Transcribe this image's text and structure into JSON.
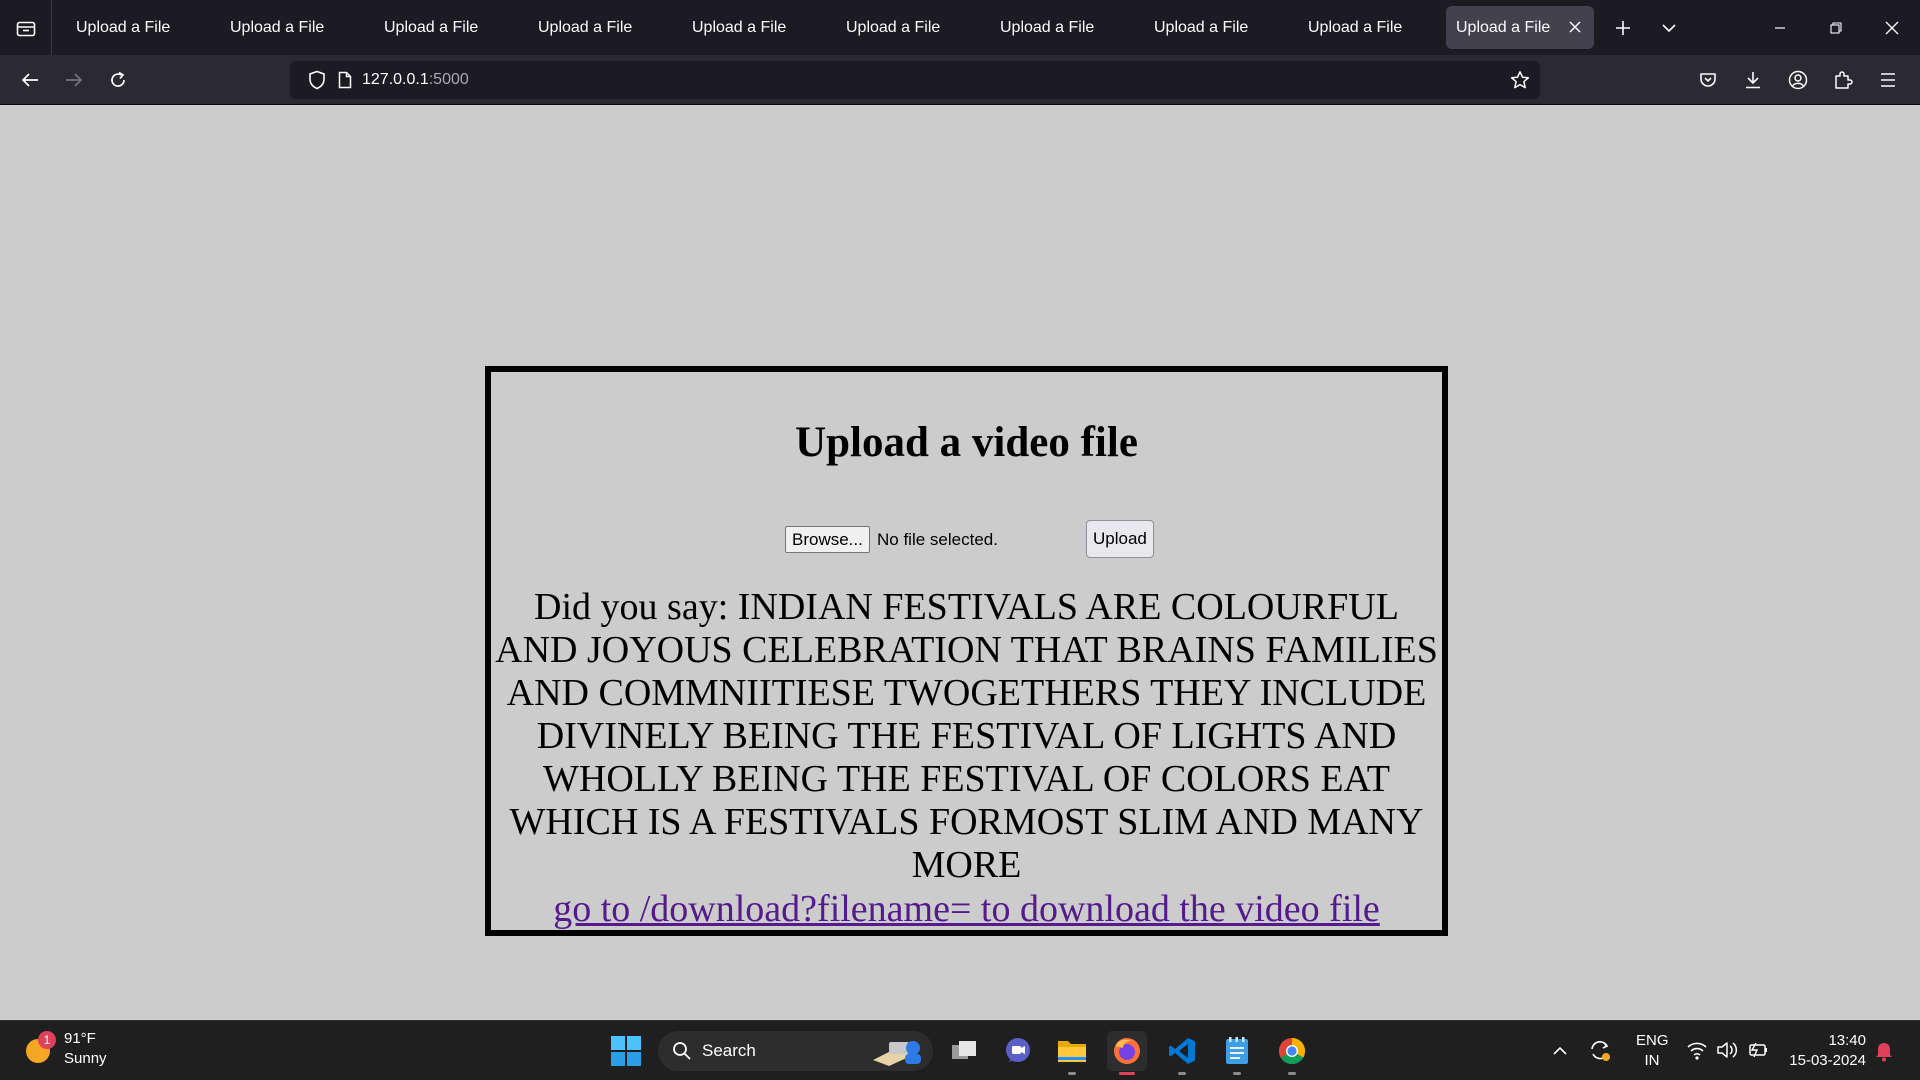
{
  "tabs": [
    {
      "title": "Upload a File"
    },
    {
      "title": "Upload a File"
    },
    {
      "title": "Upload a File"
    },
    {
      "title": "Upload a File"
    },
    {
      "title": "Upload a File"
    },
    {
      "title": "Upload a File"
    },
    {
      "title": "Upload a File"
    },
    {
      "title": "Upload a File"
    },
    {
      "title": "Upload a File"
    },
    {
      "title": "Upload a File",
      "active": true
    }
  ],
  "address_bar": {
    "host": "127.0.0.1",
    "port": ":5000"
  },
  "page": {
    "heading": "Upload a video file",
    "browse_label": "Browse...",
    "file_status": "No file selected.",
    "upload_label": "Upload",
    "transcript": "Did you say: INDIAN FESTIVALS ARE COLOURFUL AND JOYOUS CELEBRATION THAT BRAINS FAMILIES AND COMMNIITIESE TWOGETHERS THEY INCLUDE DIVINELY BEING THE FESTIVAL OF LIGHTS AND WHOLLY BEING THE FESTIVAL OF COLORS EAT WHICH IS A FESTIVALS FORMOST SLIM AND MANY MORE",
    "download_link": "go to /download?filename= to download the video file"
  },
  "taskbar": {
    "weather": {
      "temp": "91°F",
      "condition": "Sunny",
      "badge": "1"
    },
    "search_label": "Search",
    "language": {
      "line1": "ENG",
      "line2": "IN"
    },
    "time": "13:40",
    "date": "15-03-2024",
    "apps": [
      "task-view",
      "teams",
      "file-explorer",
      "firefox",
      "vscode",
      "notepad",
      "chrome"
    ]
  },
  "colors": {
    "page_background": "#cccccc",
    "visited_link": "#551a8b",
    "browser_chrome": "#1c1b22"
  }
}
